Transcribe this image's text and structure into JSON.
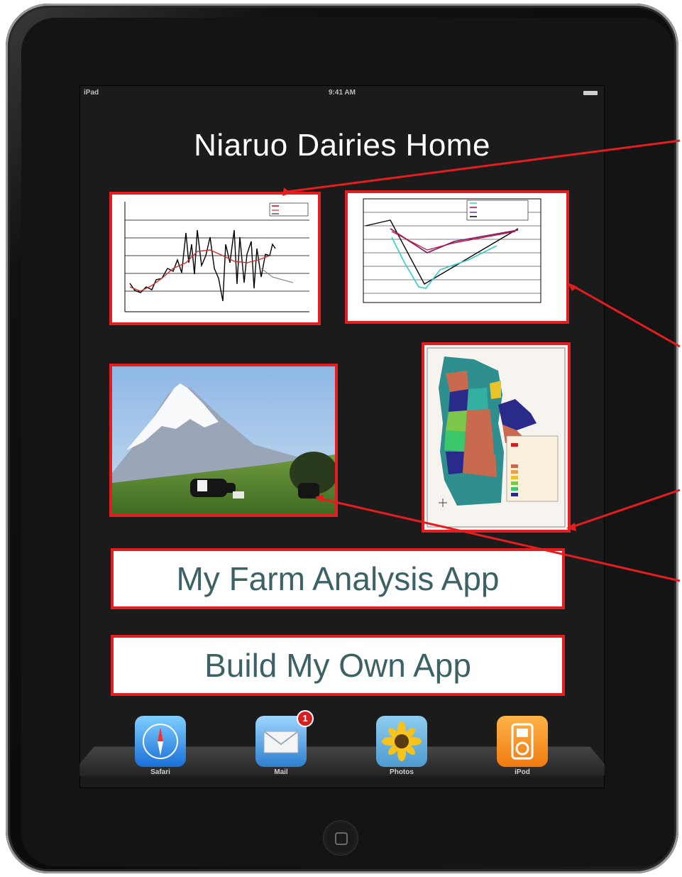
{
  "status_bar": {
    "carrier": "iPad",
    "time": "9:41 AM"
  },
  "home": {
    "title": "Niaruo Dairies Home",
    "buttons": {
      "farm_analysis": "My Farm Analysis App",
      "build_app": "Build My Own App"
    }
  },
  "dock": {
    "apps": [
      {
        "label": "Safari",
        "icon": "safari-compass-icon"
      },
      {
        "label": "Mail",
        "icon": "mail-envelope-icon",
        "badge": "1"
      },
      {
        "label": "Photos",
        "icon": "sunflower-photos-icon"
      },
      {
        "label": "iPod",
        "icon": "ipod-icon"
      }
    ]
  },
  "colors": {
    "highlight": "#e41e1e",
    "button_text": "#3d6266",
    "screen_bg": "#1b1b1b"
  }
}
